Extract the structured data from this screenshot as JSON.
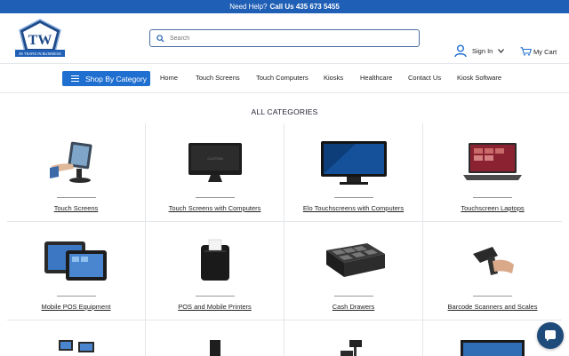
{
  "topbar": {
    "help_text": "Need Help?",
    "phone_text": "Call Us 435 673 5455"
  },
  "header": {
    "logo_text": "TW",
    "logo_subtext": "45 YEARS IN BUSINESS",
    "search_placeholder": "Search",
    "signin_label": "Sign In",
    "cart_label": "My Cart"
  },
  "nav": {
    "shop_button": "Shop By Category",
    "links": [
      "Home",
      "Touch Screens",
      "Touch Computers",
      "Kiosks",
      "Healthcare",
      "Contact Us",
      "Kiosk Software"
    ]
  },
  "main": {
    "title": "ALL CATEGORIES",
    "categories": [
      "Touch Screens",
      "Touch Screens with Computers",
      "Elo Touchscreens with Computers",
      "Touchscreen Laptops",
      "Mobile POS Equipment",
      "POS and Mobile Printers",
      "Cash Drawers",
      "Barcode Scanners and Scales"
    ]
  },
  "colors": {
    "brand_blue": "#1f5fb5",
    "button_blue": "#1f6fd0",
    "chat_bubble": "#1f4b7a"
  }
}
